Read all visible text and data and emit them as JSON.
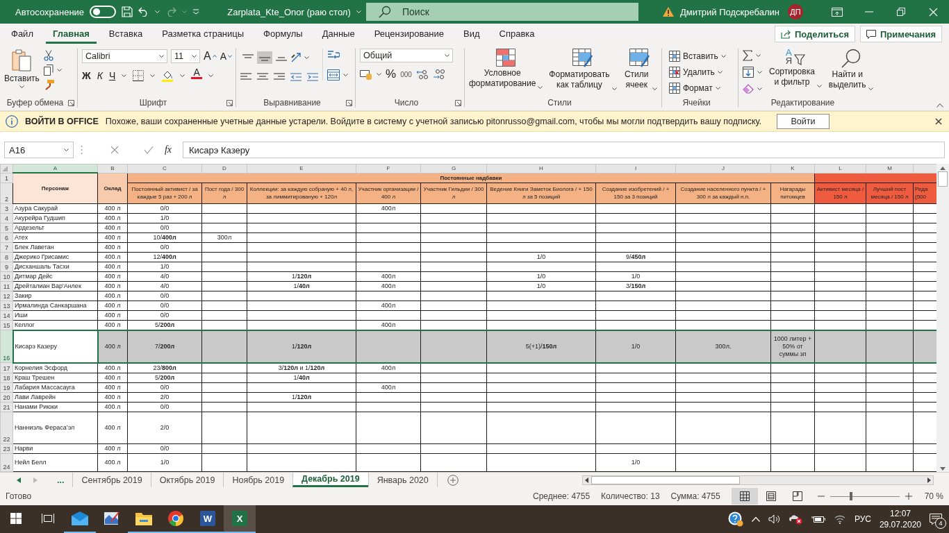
{
  "title_bar": {
    "autosave": {
      "label": "Автосохранение",
      "on": false
    },
    "title": "Zarplata_Kte_Onor (раю стол)",
    "search": {
      "placeholder": "Поиск"
    },
    "user": "Дмитрий Подскребалин",
    "avatar": "ДП"
  },
  "menu": {
    "tabs": [
      {
        "label": "Файл",
        "selected": false
      },
      {
        "label": "Главная",
        "selected": true
      },
      {
        "label": "Вставка",
        "selected": false
      },
      {
        "label": "Разметка страницы",
        "selected": false
      },
      {
        "label": "Формулы",
        "selected": false
      },
      {
        "label": "Данные",
        "selected": false
      },
      {
        "label": "Рецензирование",
        "selected": false
      },
      {
        "label": "Вид",
        "selected": false
      },
      {
        "label": "Справка",
        "selected": false
      }
    ],
    "share": "Поделиться",
    "comments": "Примечания"
  },
  "ribbon": {
    "clipboard": {
      "paste": "Вставить",
      "label": "Буфер обмена"
    },
    "font": {
      "family": "Calibri",
      "size": "11",
      "grow": "A",
      "shrink": "A",
      "bold": "Ж",
      "italic": "К",
      "underline": "Ч",
      "font_color": "A",
      "label": "Шрифт"
    },
    "alignment": {
      "vertical": [
        {
          "selected": false
        },
        {
          "selected": true
        },
        {
          "selected": false
        }
      ],
      "label": "Выравнивание"
    },
    "number": {
      "format": "Общий",
      "percent": "%",
      "thousands": "000",
      "label": "Число"
    },
    "styles": {
      "items": [
        "Условное форматирование",
        "Форматировать как таблицу",
        "Стили ячеек"
      ],
      "label": "Стили"
    },
    "cells": {
      "items": [
        "Вставить",
        "Удалить",
        "Формат"
      ],
      "label": "Ячейки"
    },
    "editing": {
      "sort_letters": [
        "A",
        "Я"
      ],
      "items": [
        "Сортировка и фильтр",
        "Найти и выделить"
      ],
      "label": "Редактирование"
    }
  },
  "notice": {
    "title": "ВОЙТИ В OFFICE",
    "message": "Похоже, ваши сохраненные учетные данные устарели. Войдите в систему с учетной записью pitonrusso@gmail.com, чтобы мы могли подтвердить вашу подписку.",
    "button": "Войти"
  },
  "formula_bar": {
    "name_box": "A16",
    "fx": "fx",
    "value": "Кисарэ Казеру"
  },
  "sheet": {
    "columns": [
      {
        "letter": "A",
        "selected": true
      },
      {
        "letter": "B",
        "selected": false
      },
      {
        "letter": "C",
        "selected": false
      },
      {
        "letter": "D",
        "selected": false
      },
      {
        "letter": "E",
        "selected": false
      },
      {
        "letter": "F",
        "selected": false
      },
      {
        "letter": "G",
        "selected": false
      },
      {
        "letter": "H",
        "selected": false
      },
      {
        "letter": "I",
        "selected": false
      },
      {
        "letter": "J",
        "selected": false
      },
      {
        "letter": "K",
        "selected": false
      },
      {
        "letter": "L",
        "selected": false
      },
      {
        "letter": "M",
        "selected": false
      }
    ],
    "header_row_numbers": [
      "1",
      "2"
    ],
    "name_header": "Персонаж",
    "salary_header": "Оклад",
    "group_headers": [
      {
        "text": "Постоянные надбавки",
        "color": "#f4b183"
      },
      {
        "color": "#ef5b3f"
      }
    ],
    "column_headers": [
      {
        "text": "Постоянный активист / за каждые 5 раз + 200 л",
        "color": "#f4b183"
      },
      {
        "text": "Пост года / 300 л",
        "color": "#f4b183"
      },
      {
        "text": "Коллекции: за каждую собраную + 40 л, за лиммитированую + 120л",
        "color": "#f4b183"
      },
      {
        "text": "Участник организации / 400 л",
        "color": "#f4b183"
      },
      {
        "text": "Участник Гильдии / 300 л",
        "color": "#f4b183"
      },
      {
        "text": "Ведение Книги Заметок Биолога / + 150 л за 5 позиций",
        "color": "#f4b183"
      },
      {
        "text": "Создание изобретений / + 150 за 3 позиций",
        "color": "#f4b183"
      },
      {
        "text": "Создание населенного пункта / + 300 л за каждый н.п.",
        "color": "#f4b183"
      },
      {
        "text": "Нагарады питомцев",
        "color": "#f4b183"
      },
      {
        "text": "Активист месяца / 150 л",
        "color": "#ef5b3f"
      },
      {
        "text": "Лучший пост месяца / 150 л",
        "color": "#ef5b3f"
      },
      {
        "text": "Реда (500",
        "color": "#ef5b3f"
      }
    ],
    "rows": [
      {
        "num": "3",
        "kind": "normal",
        "selected": false,
        "highlighted": false,
        "a": "Азура Сакурай",
        "b": "400 л",
        "c": "0/0",
        "f": "400л"
      },
      {
        "num": "4",
        "kind": "normal",
        "selected": false,
        "highlighted": false,
        "a": "Акурейра Гудшип",
        "b": "400 л",
        "c": "1/0"
      },
      {
        "num": "5",
        "kind": "normal",
        "selected": false,
        "highlighted": false,
        "a": "Ардезельт",
        "b": "400 л",
        "c": "0/0"
      },
      {
        "num": "6",
        "kind": "normal",
        "selected": false,
        "highlighted": false,
        "a": "Атех",
        "b": "400 л",
        "c": "10/**400л**",
        "d": "300л"
      },
      {
        "num": "7",
        "kind": "normal",
        "selected": false,
        "highlighted": false,
        "a": "Блек Лаветан",
        "b": "400 л",
        "c": "0/0"
      },
      {
        "num": "8",
        "kind": "normal",
        "selected": false,
        "highlighted": false,
        "a": "Джерико Грисамис",
        "b": "400 л",
        "c": "12/**400л**",
        "h": "1/0",
        "i": "9/**450л**"
      },
      {
        "num": "9",
        "kind": "normal",
        "selected": false,
        "highlighted": false,
        "a": "Дисханшаль Тасхи",
        "b": "400 л",
        "c": "1/0"
      },
      {
        "num": "10",
        "kind": "normal",
        "selected": false,
        "highlighted": false,
        "a": "Дитмар Дейс",
        "b": "400 л",
        "c": "4/0",
        "e": "1/**120л**",
        "f": "400л",
        "h": "1/0",
        "i": "1/0"
      },
      {
        "num": "11",
        "kind": "normal",
        "selected": false,
        "highlighted": false,
        "a": "Дрейталиан Вар'Анлек",
        "b": "400 л",
        "c": "4/0",
        "e": "1/**40л**",
        "f": "400л",
        "h": "1/0",
        "i": "3/**150л**"
      },
      {
        "num": "12",
        "kind": "normal",
        "selected": false,
        "highlighted": false,
        "a": "Закир",
        "b": "400 л",
        "c": "0/0"
      },
      {
        "num": "13",
        "kind": "normal",
        "selected": false,
        "highlighted": false,
        "a": "Ирмалинда Санкаршана",
        "b": "400 л",
        "c": "0/0",
        "f": "400л"
      },
      {
        "num": "14",
        "kind": "normal",
        "selected": false,
        "highlighted": false,
        "a": "Иши",
        "b": "400 л",
        "c": "0/0"
      },
      {
        "num": "15",
        "kind": "normal",
        "selected": false,
        "highlighted": false,
        "a": "Келлог",
        "b": "400 л",
        "c": "5/**200л**",
        "f": "400л"
      },
      {
        "num": "16",
        "kind": "tall",
        "selected": true,
        "highlighted": true,
        "a": "Кисарэ Казеру",
        "b": "400 л",
        "c": "7/**200л**",
        "e": "1/**120л**",
        "h": "5(+1)/**150л**",
        "i": "1/0",
        "j": "300л.",
        "k": "1000 литер + 50% от суммы зп"
      },
      {
        "num": "17",
        "kind": "normal",
        "selected": false,
        "highlighted": false,
        "a": "Корнелия Эсфорд",
        "b": "400 л",
        "c": "23/**800л**",
        "e": "3/**120л** и 1/**120л**",
        "f": "400л"
      },
      {
        "num": "18",
        "kind": "normal",
        "selected": false,
        "highlighted": false,
        "a": "Краш Трешен",
        "b": "400 л",
        "c": "5/**200л**",
        "e": "1/**40л**"
      },
      {
        "num": "19",
        "kind": "normal",
        "selected": false,
        "highlighted": false,
        "a": "Лабария Массасауга",
        "b": "400 л",
        "c": "0/0",
        "f": "400л"
      },
      {
        "num": "20",
        "kind": "normal",
        "selected": false,
        "highlighted": false,
        "a": "Лави Лаврейн",
        "b": "400 л",
        "c": "2/0",
        "e": "1/**120л**"
      },
      {
        "num": "21",
        "kind": "normal",
        "selected": false,
        "highlighted": false,
        "a": "Нанами Риюки",
        "b": "400 л",
        "c": "0/0"
      },
      {
        "num": "22",
        "kind": "tall",
        "selected": false,
        "highlighted": false,
        "a": "Нанниэль Фераса’эл",
        "b": "400 л",
        "c": "2/0"
      },
      {
        "num": "23",
        "kind": "normal",
        "selected": false,
        "highlighted": false,
        "a": "Нарви",
        "b": "400 л",
        "c": "0/0"
      },
      {
        "num": "24",
        "kind": "medium",
        "selected": false,
        "highlighted": false,
        "a": "Нейл Белл",
        "b": "400 л",
        "c": "1/0",
        "i": "1/0"
      }
    ]
  },
  "sheet_tabs": {
    "more": "...",
    "tabs": [
      {
        "label": "Сентябрь 2019",
        "selected": false
      },
      {
        "label": "Октябрь 2019",
        "selected": false
      },
      {
        "label": "Ноябрь 2019",
        "selected": false
      },
      {
        "label": "Декабрь 2019",
        "selected": true
      },
      {
        "label": "Январь 2020",
        "selected": false
      }
    ]
  },
  "status_bar": {
    "ready": "Готово",
    "stats": [
      "Среднее: 4755",
      "Количество: 13",
      "Сумма: 4755"
    ],
    "views": [
      {
        "selected": true
      },
      {
        "selected": false
      },
      {
        "selected": false
      }
    ],
    "zoom": {
      "level": 0.3,
      "reading": "70 %"
    }
  },
  "taskbar": {
    "apps": [
      {
        "kind": "start",
        "running": false,
        "selected": false
      },
      {
        "kind": "task-view",
        "running": false,
        "selected": false
      },
      {
        "kind": "mail",
        "running": true,
        "selected": false
      },
      {
        "kind": "paint",
        "running": false,
        "selected": false
      },
      {
        "kind": "folder",
        "running": true,
        "selected": false
      },
      {
        "kind": "browser",
        "running": true,
        "selected": false
      },
      {
        "kind": "word",
        "letter": "W",
        "running": true,
        "selected": false
      },
      {
        "kind": "excel",
        "letter": "X",
        "running": true,
        "selected": true
      }
    ],
    "language": "РУС",
    "time": "12:07",
    "date": "29.07.2020",
    "notifications": "4"
  }
}
